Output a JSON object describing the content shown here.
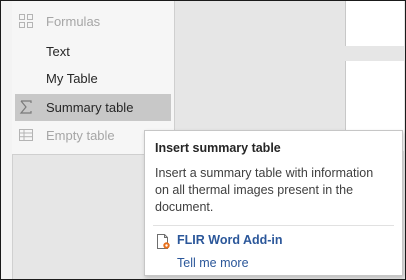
{
  "menu": {
    "items": [
      {
        "label": "Formulas",
        "icon": "formula-grid-icon",
        "state": "disabled"
      },
      {
        "label": "Text",
        "icon": "",
        "state": "normal"
      },
      {
        "label": "My Table",
        "icon": "",
        "state": "normal"
      },
      {
        "label": "Summary table",
        "icon": "sigma-icon",
        "state": "highlighted"
      },
      {
        "label": "Empty table",
        "icon": "table-grid-icon",
        "state": "disabled"
      }
    ]
  },
  "tooltip": {
    "title": "Insert summary table",
    "description": "Insert a summary table with information on all thermal images present in the document.",
    "addin_name": "FLIR Word Add-in",
    "addin_icon": "document-gear-icon",
    "link_text": "Tell me more"
  },
  "colors": {
    "highlight": "#c8c8c8",
    "link": "#2b579a",
    "disabled_text": "#a6a6a6",
    "addin_icon_accent": "#e8701a"
  }
}
